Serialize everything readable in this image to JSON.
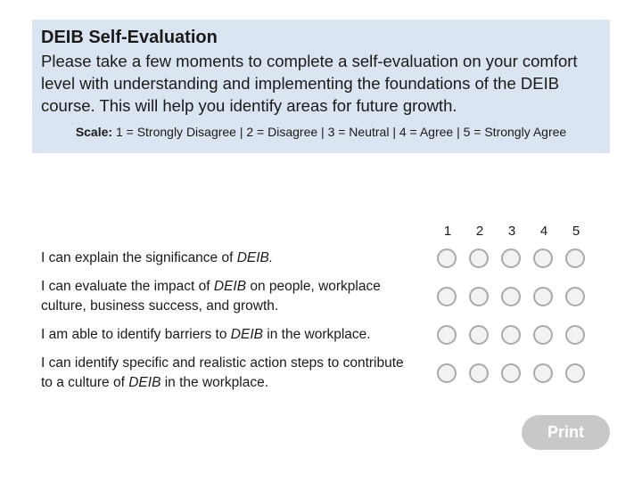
{
  "header": {
    "title": "DEIB Self-Evaluation",
    "intro": "Please take a few moments to complete a self-evaluation on your comfort level with understanding and implementing the foundations of the DEIB course. This will help you identify areas for future growth.",
    "scale_label": "Scale:",
    "scale_text": " 1 = Strongly Disagree | 2 = Disagree | 3 = Neutral | 4 = Agree | 5 = Strongly Agree"
  },
  "scale_numbers": [
    "1",
    "2",
    "3",
    "4",
    "5"
  ],
  "statements": [
    {
      "pre": "I can explain the significance of ",
      "em": "DEIB.",
      "post": ""
    },
    {
      "pre": "I can evaluate the impact of ",
      "em": "DEIB",
      "post": " on people, workplace culture, business success, and growth."
    },
    {
      "pre": "I am able to identify barriers to ",
      "em": "DEIB",
      "post": " in the workplace."
    },
    {
      "pre": "I can identify specific and realistic action steps to contribute to a culture of ",
      "em": "DEIB",
      "post": " in the workplace."
    }
  ],
  "print_label": "Print",
  "colors": {
    "panel": "#dbe5f1",
    "radio_border": "#aaaaaa",
    "button_disabled": "#c8c8c8"
  }
}
